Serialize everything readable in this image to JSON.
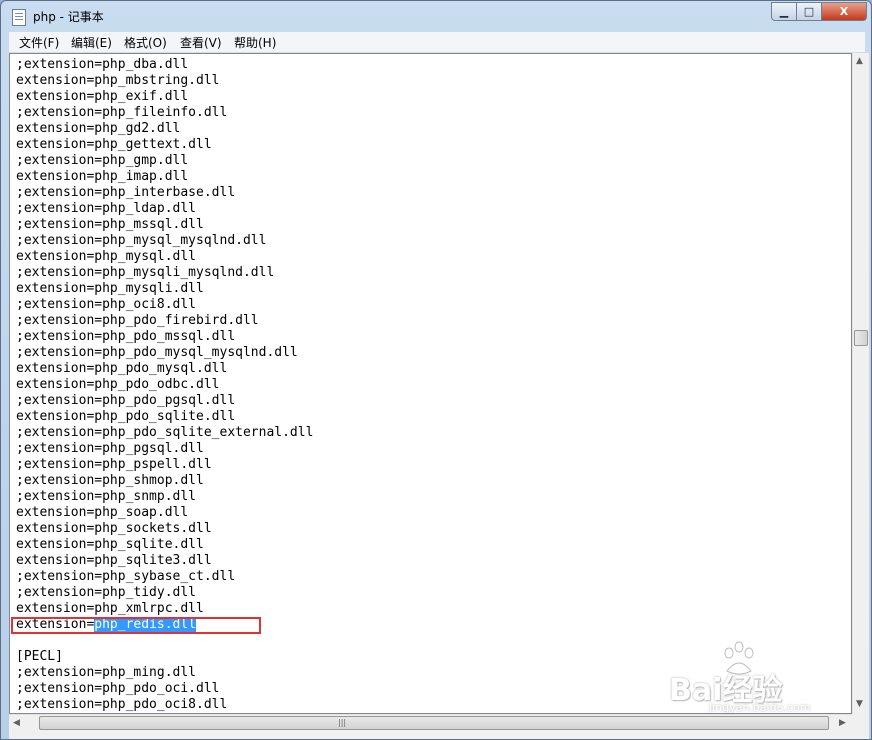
{
  "window": {
    "title": "php - 记事本",
    "controls": {
      "minimize": "▁",
      "maximize": "□",
      "close": "X"
    }
  },
  "menu": [
    {
      "label": "文件(F)"
    },
    {
      "label": "编辑(E)"
    },
    {
      "label": "格式(O)"
    },
    {
      "label": "查看(V)"
    },
    {
      "label": "帮助(H)"
    }
  ],
  "editor": {
    "lines": [
      ";extension=php_dba.dll",
      "extension=php_mbstring.dll",
      "extension=php_exif.dll",
      ";extension=php_fileinfo.dll",
      "extension=php_gd2.dll",
      "extension=php_gettext.dll",
      ";extension=php_gmp.dll",
      "extension=php_imap.dll",
      ";extension=php_interbase.dll",
      ";extension=php_ldap.dll",
      ";extension=php_mssql.dll",
      ";extension=php_mysql_mysqlnd.dll",
      "extension=php_mysql.dll",
      ";extension=php_mysqli_mysqlnd.dll",
      "extension=php_mysqli.dll",
      ";extension=php_oci8.dll",
      ";extension=php_pdo_firebird.dll",
      ";extension=php_pdo_mssql.dll",
      ";extension=php_pdo_mysql_mysqlnd.dll",
      "extension=php_pdo_mysql.dll",
      "extension=php_pdo_odbc.dll",
      ";extension=php_pdo_pgsql.dll",
      "extension=php_pdo_sqlite.dll",
      ";extension=php_pdo_sqlite_external.dll",
      ";extension=php_pgsql.dll",
      ";extension=php_pspell.dll",
      ";extension=php_shmop.dll",
      ";extension=php_snmp.dll",
      "extension=php_soap.dll",
      "extension=php_sockets.dll",
      "extension=php_sqlite.dll",
      "extension=php_sqlite3.dll",
      ";extension=php_sybase_ct.dll",
      ";extension=php_tidy.dll",
      "extension=php_xmlrpc.dll"
    ],
    "highlighted_line": {
      "prefix": "extension=",
      "selected": "php_redis.dll"
    },
    "after_lines": [
      "",
      "[PECL]",
      ";extension=php_ming.dll",
      ";extension=php_pdo_oci.dll",
      ";extension=php_pdo_oci8.dll"
    ]
  },
  "scrollbar": {
    "up": "▲",
    "down": "▼",
    "left": "◀",
    "right": "▶",
    "grip": "|||"
  },
  "watermark": {
    "brand": "Bai经验",
    "url": "jingyan.baidu.com"
  },
  "colors": {
    "selection": "#3399ff",
    "annotation_box": "#e03232",
    "titlebar": "#c9dcf0"
  }
}
